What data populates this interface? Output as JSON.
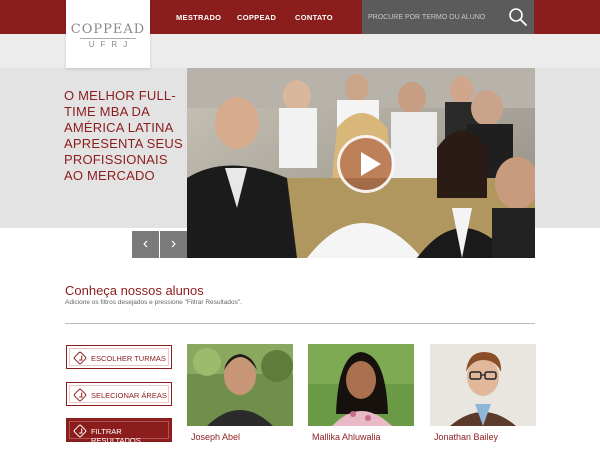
{
  "logo": {
    "main": "COPPEAD",
    "sub": "UFRJ"
  },
  "nav": {
    "items": [
      "MESTRADO",
      "COPPEAD",
      "CONTATO"
    ]
  },
  "search": {
    "placeholder": "PROCURE POR TERMO OU ALUNO"
  },
  "hero": {
    "headline": "O MELHOR FULL-TIME MBA DA AMÉRICA LATINA APRESENTA SEUS PROFISSIONAIS AO MERCADO"
  },
  "section": {
    "title": "Conheça nossos alunos",
    "subtitle": "Adicione os filtros desejados e pressione \"Filtrar Resultados\"."
  },
  "filters": [
    "ESCOLHER TURMAS",
    "SELECIONAR ÁREAS",
    "FILTRAR RESULTADOS"
  ],
  "students": [
    "Joseph Abel",
    "Mallika Ahluwalia",
    "Jonathan Bailey"
  ],
  "colors": {
    "brand": "#8c1d1d",
    "search_bg": "#5b5b5b"
  },
  "icons": {
    "search": "search-icon",
    "play": "play-icon",
    "prev": "chevron-left-icon",
    "next": "chevron-right-icon"
  }
}
